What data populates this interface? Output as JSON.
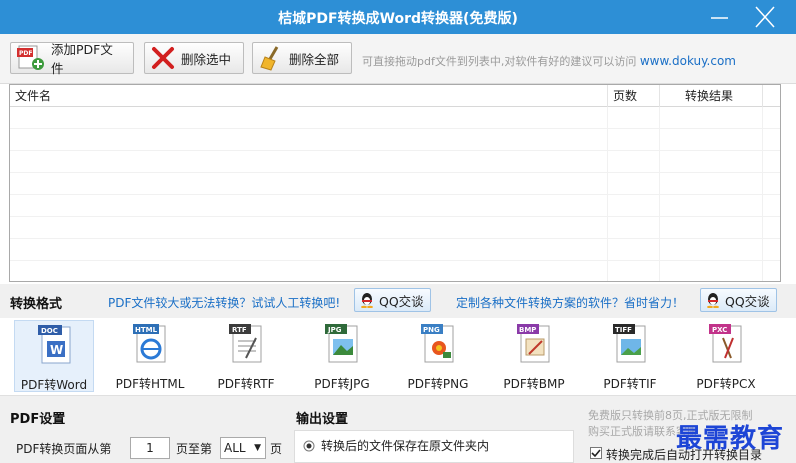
{
  "window": {
    "title": "桔城PDF转换成Word转换器(免费版)",
    "minimize_glyph": "—",
    "close_glyph": "✕"
  },
  "toolbar": {
    "add_label": "添加PDF文件",
    "delete_selected_label": "删除选中",
    "delete_all_label": "删除全部",
    "hint_text": "可直接拖动pdf文件到列表中,对软件有好的建议可以访问",
    "hint_link": "www.dokuy.com"
  },
  "file_table": {
    "columns": [
      "文件名",
      "页数",
      "转换结果"
    ],
    "rows": []
  },
  "format_bar": {
    "title": "转换格式",
    "link1": "PDF文件较大或无法转换？试试人工转换吧!",
    "qq1_label": "QQ交谈",
    "link2": "定制各种文件转换方案的软件？省时省力！",
    "qq2_label": "QQ交谈"
  },
  "formats": [
    {
      "badge": "DOC",
      "label": "PDF转Word",
      "color": "#2f5da8",
      "selected": true
    },
    {
      "badge": "HTML",
      "label": "PDF转HTML",
      "color": "#2d6fb6",
      "selected": false
    },
    {
      "badge": "RTF",
      "label": "PDF转RTF",
      "color": "#3c3c3c",
      "selected": false
    },
    {
      "badge": "JPG",
      "label": "PDF转JPG",
      "color": "#2f6a3a",
      "selected": false
    },
    {
      "badge": "PNG",
      "label": "PDF转PNG",
      "color": "#3a7fc4",
      "selected": false
    },
    {
      "badge": "BMP",
      "label": "PDF转BMP",
      "color": "#8a3aa8",
      "selected": false
    },
    {
      "badge": "TIFF",
      "label": "PDF转TIF",
      "color": "#2a2a2a",
      "selected": false
    },
    {
      "badge": "PXC",
      "label": "PDF转PCX",
      "color": "#c2338a",
      "selected": false
    }
  ],
  "pdf_settings": {
    "title": "PDF设置",
    "range_prefix": "PDF转换页面从第",
    "start_page": "1",
    "range_mid": "页至第",
    "end_value": "ALL",
    "range_suffix": "页"
  },
  "output_settings": {
    "title": "输出设置",
    "option_same_folder": "转换后的文件保存在原文件夹内"
  },
  "notice": {
    "line1": "免费版只转换前8页,正式版无限制",
    "line2": "购买正式版请联系客服",
    "auto_open_label": "转换完成后自动打开转换目录"
  },
  "watermark": "最需教育"
}
